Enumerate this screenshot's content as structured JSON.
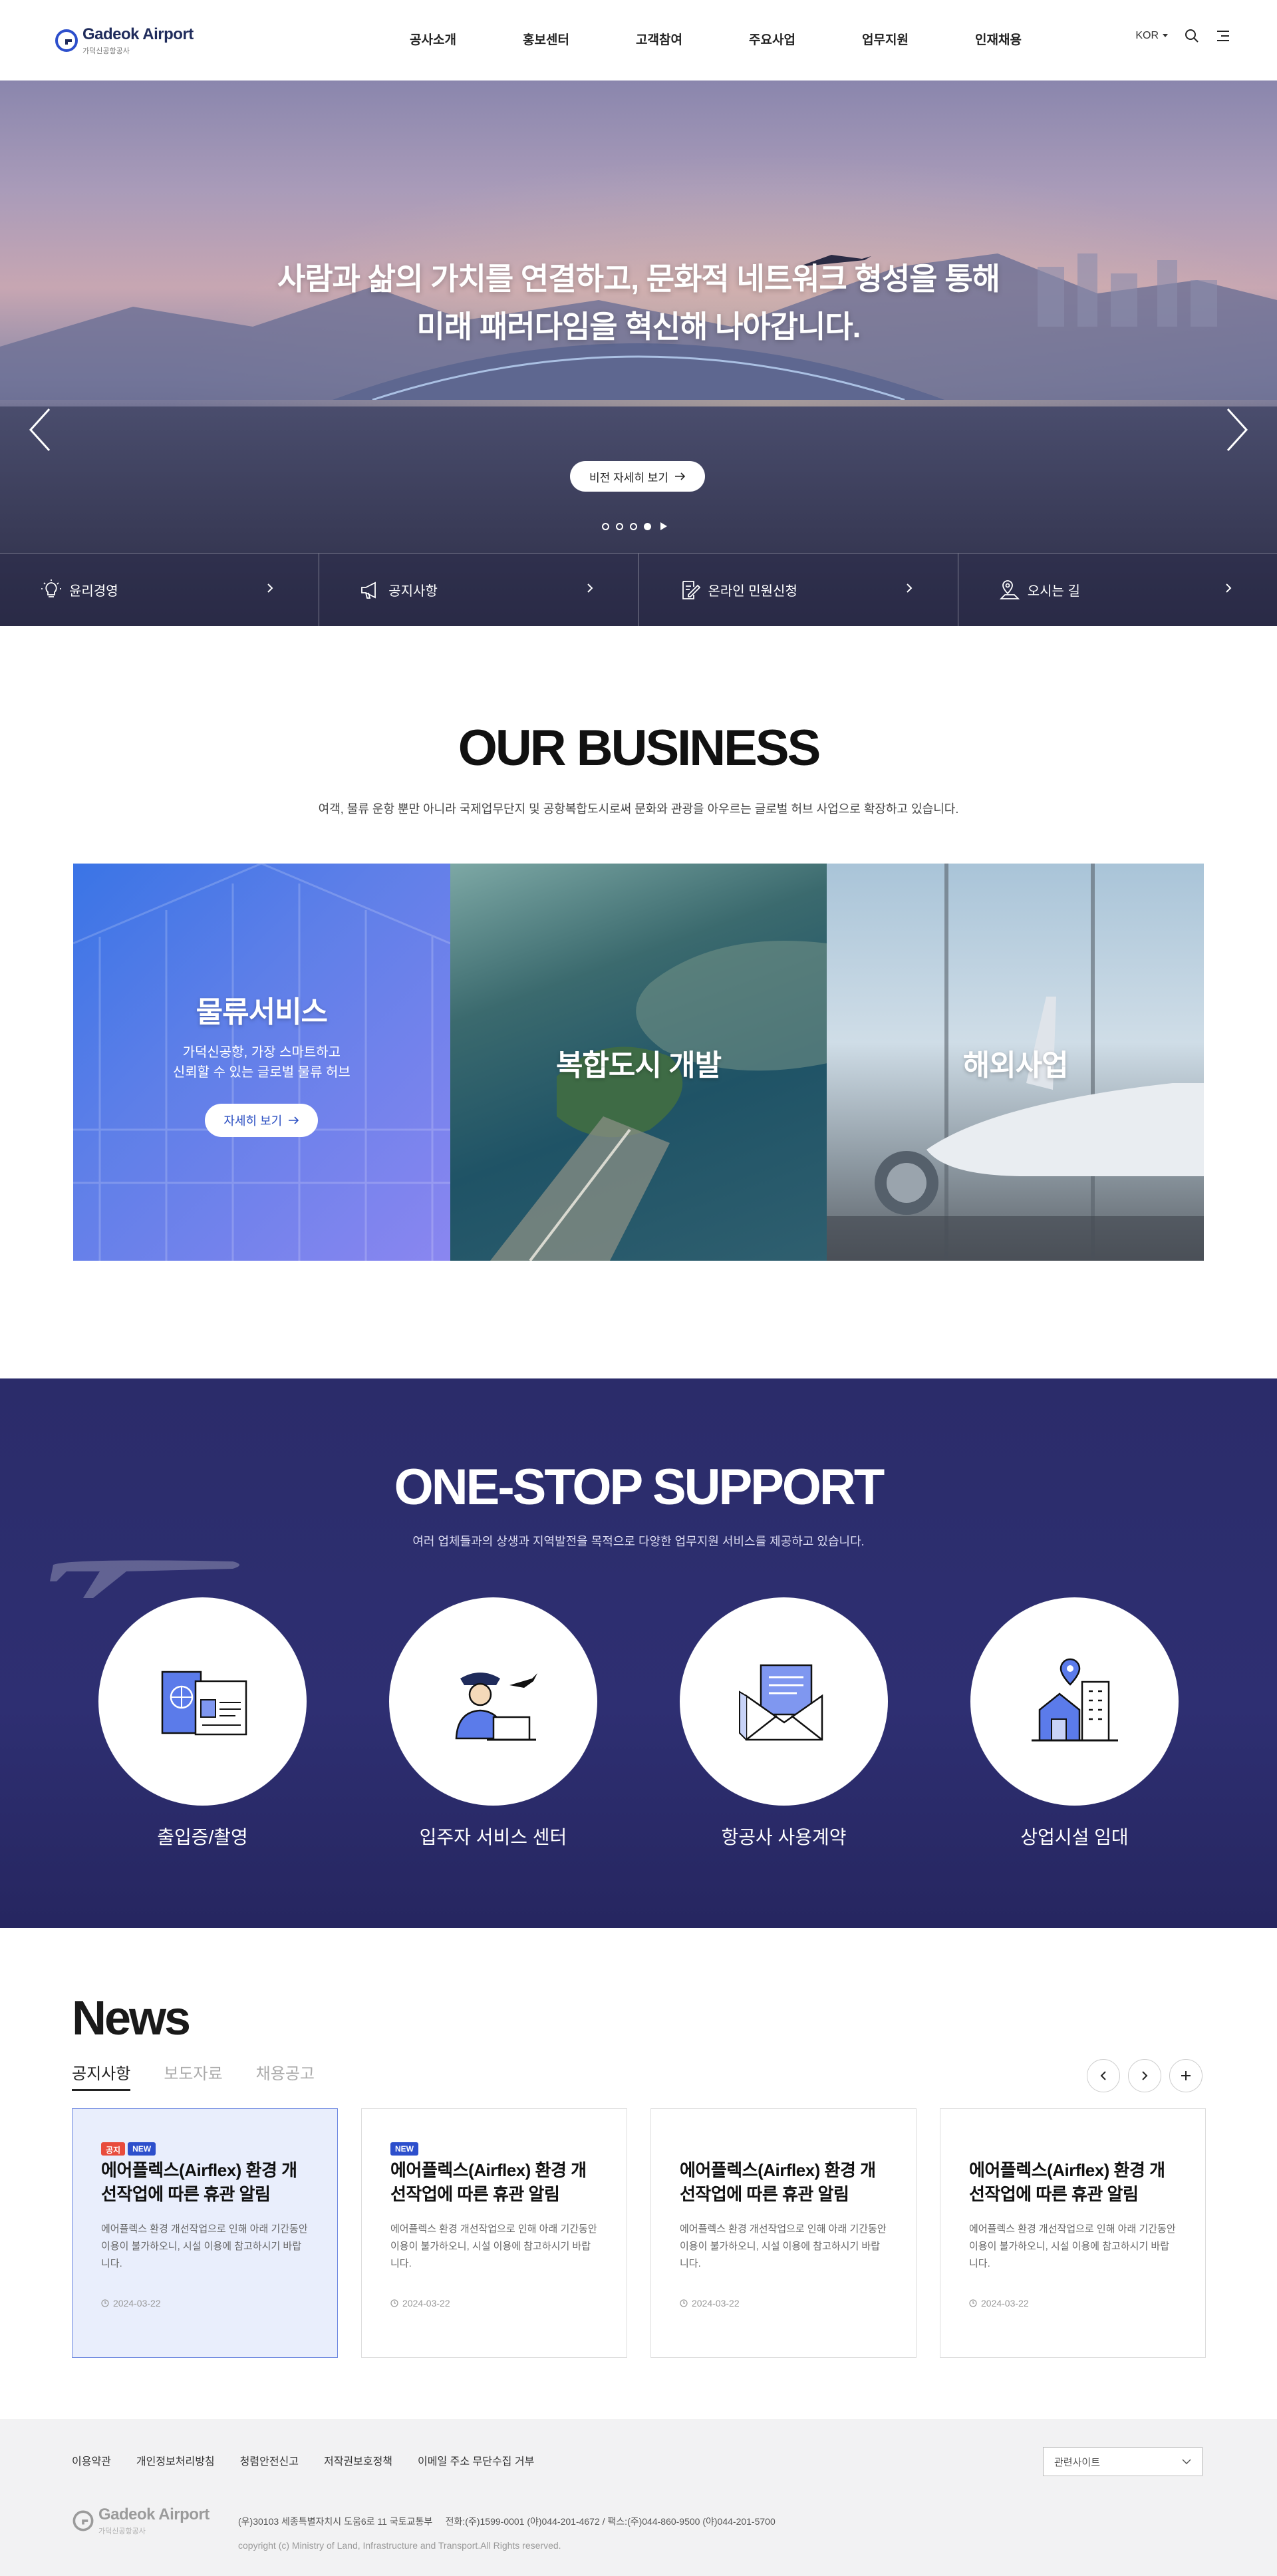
{
  "header": {
    "logo_name": "Gadeok Airport",
    "logo_sub": "가덕신공항공사",
    "nav": [
      "공사소개",
      "홍보센터",
      "고객참여",
      "주요사업",
      "업무지원",
      "인재채용"
    ],
    "lang": "KOR"
  },
  "hero": {
    "title_line1": "사람과 삶의 가치를 연결하고, 문화적 네트워크 형성을 통해",
    "title_line2": "미래 패러다임을 혁신해 나아갑니다.",
    "button": "비전 자세히 보기",
    "slides": 4,
    "active_slide": 4,
    "quick_links": [
      {
        "label": "윤리경영",
        "icon": "lightbulb-icon"
      },
      {
        "label": "공지사항",
        "icon": "megaphone-icon"
      },
      {
        "label": "온라인 민원신청",
        "icon": "document-edit-icon"
      },
      {
        "label": "오시는 길",
        "icon": "map-pin-icon"
      }
    ]
  },
  "business": {
    "title": "OUR BUSINESS",
    "desc": "여객, 물류 운항 뿐만 아니라 국제업무단지 및 공항복합도시로써 문화와 관광을 아우르는 글로벌 허브 사업으로 확장하고 있습니다.",
    "cards": [
      {
        "title": "물류서비스",
        "desc1": "가덕신공항, 가장 스마트하고",
        "desc2": "신뢰할 수 있는 글로벌 물류 허브",
        "button": "자세히 보기"
      },
      {
        "title": "복합도시 개발"
      },
      {
        "title": "해외사업"
      }
    ]
  },
  "support": {
    "title": "ONE-STOP SUPPORT",
    "desc": "여러 업체들과의 상생과 지역발전을 목적으로 다양한 업무지원 서비스를 제공하고 있습니다.",
    "items": [
      {
        "label": "출입증/촬영",
        "icon": "passport-card-icon"
      },
      {
        "label": "입주자 서비스 센터",
        "icon": "staff-laptop-icon"
      },
      {
        "label": "항공사 사용계약",
        "icon": "envelope-document-icon"
      },
      {
        "label": "상업시설 임대",
        "icon": "building-location-icon"
      }
    ]
  },
  "news": {
    "title": "News",
    "tabs": [
      "공지사항",
      "보도자료",
      "채용공고"
    ],
    "active_tab": 0,
    "items": [
      {
        "badges": [
          "공지",
          "NEW"
        ],
        "title": "에어플렉스(Airflex) 환경 개선작업에 따른 휴관 알림",
        "body": "에어플렉스 환경 개선작업으로 인해 아래 기간동안 이용이 불가하오니, 시설 이용에 참고하시기 바랍니다.",
        "date": "2024-03-22"
      },
      {
        "badges": [
          "NEW"
        ],
        "title": "에어플렉스(Airflex) 환경 개선작업에 따른 휴관 알림",
        "body": "에어플렉스 환경 개선작업으로 인해 아래 기간동안 이용이 불가하오니, 시설 이용에 참고하시기 바랍니다.",
        "date": "2024-03-22"
      },
      {
        "badges": [],
        "title": "에어플렉스(Airflex) 환경 개선작업에 따른 휴관 알림",
        "body": "에어플렉스 환경 개선작업으로 인해 아래 기간동안 이용이 불가하오니, 시설 이용에 참고하시기 바랍니다.",
        "date": "2024-03-22"
      },
      {
        "badges": [],
        "title": "에어플렉스(Airflex) 환경 개선작업에 따른 휴관 알림",
        "body": "에어플렉스 환경 개선작업으로 인해 아래 기간동안 이용이 불가하오니, 시설 이용에 참고하시기 바랍니다.",
        "date": "2024-03-22"
      }
    ]
  },
  "footer": {
    "links": [
      "이용약관",
      "개인정보처리방침",
      "청렴안전신고",
      "저작권보호정책",
      "이메일 주소 무단수집 거부"
    ],
    "related_sites": "관련사이트",
    "address": "(우)30103 세종특별자치시 도움6로 11 국토교통부     전화:(주)1599-0001 (야)044-201-4672 / 팩스:(주)044-860-9500 (야)044-201-5700",
    "copyright": "copyright (c) Ministry of Land, Infrastructure and Transport.All Rights reserved."
  },
  "colors": {
    "brand": "#2d4fcc",
    "support_bg": "#2b2c6a",
    "accent_red": "#e84c3d"
  }
}
